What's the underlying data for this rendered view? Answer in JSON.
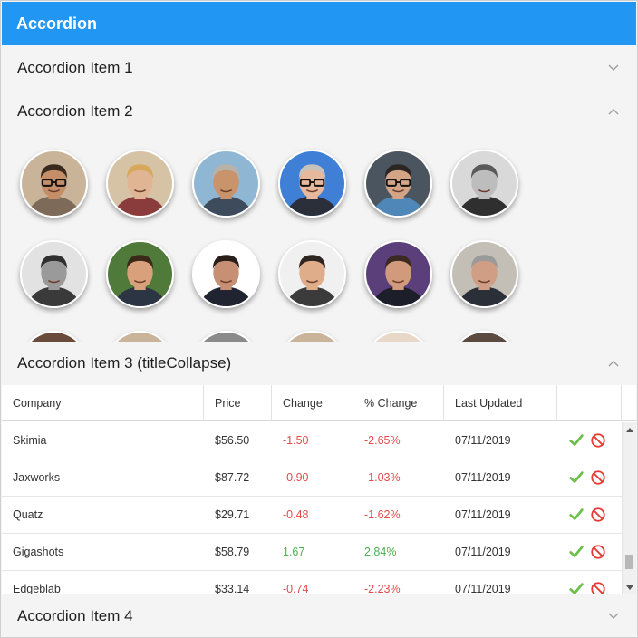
{
  "app": {
    "title": "Accordion"
  },
  "accordion": {
    "item1": {
      "title": "Accordion Item 1",
      "state": "collapsed",
      "icon": "chevron-down-icon"
    },
    "item2": {
      "title": "Accordion Item 2",
      "state": "expanded",
      "icon": "chevron-up-icon"
    },
    "item3": {
      "title": "Accordion Item 3 (titleCollapse)",
      "state": "expanded",
      "icon": "chevron-up-icon"
    },
    "item4": {
      "title": "Accordion Item 4",
      "state": "collapsed",
      "icon": "chevron-down-icon"
    }
  },
  "avatars": [
    {
      "bg": "#c9b49a",
      "skin": "#c48e68",
      "hair": "#3a2a1e",
      "shirt": "#7d6a58",
      "glasses": true
    },
    {
      "bg": "#d6c3a6",
      "skin": "#e0b594",
      "hair": "#d7a85a",
      "shirt": "#8a3b3b",
      "glasses": false
    },
    {
      "bg": "#8fb7d4",
      "skin": "#c9936b",
      "hair": "#b8b2a8",
      "shirt": "#3d4b5c",
      "glasses": false
    },
    {
      "bg": "#3f7fd6",
      "skin": "#e6b99c",
      "hair": "#c7c2bb",
      "shirt": "#2a2f3a",
      "glasses": true
    },
    {
      "bg": "#4a5560",
      "skin": "#d4a486",
      "hair": "#2c2622",
      "shirt": "#4f87b8",
      "glasses": true
    },
    {
      "bg": "#d9d9d9",
      "skin": "#bdbdbd",
      "hair": "#5a5a5a",
      "shirt": "#2f2f2f",
      "glasses": false
    },
    {
      "bg": "#e2e2e2",
      "skin": "#9a9a9a",
      "hair": "#2f2f2f",
      "shirt": "#3a3a3a",
      "glasses": false
    },
    {
      "bg": "#4f7a3a",
      "skin": "#d9a07c",
      "hair": "#3a2818",
      "shirt": "#2c3544",
      "glasses": false
    },
    {
      "bg": "#ffffff",
      "skin": "#c79075",
      "hair": "#2a1f18",
      "shirt": "#1f2430",
      "glasses": false
    },
    {
      "bg": "#f0f0f0",
      "skin": "#e0ad8a",
      "hair": "#2e2520",
      "shirt": "#3b3b3b",
      "glasses": false
    },
    {
      "bg": "#5a3f7a",
      "skin": "#d19a7c",
      "hair": "#3a2a22",
      "shirt": "#1c1f2a",
      "glasses": false
    },
    {
      "bg": "#c3beb6",
      "skin": "#cf9e85",
      "hair": "#9a9a9a",
      "shirt": "#2b2f38",
      "glasses": false
    },
    {
      "bg": "#6a4a3a",
      "skin": "#c48e68",
      "hair": "#2a1c14",
      "shirt": "#333",
      "glasses": false
    },
    {
      "bg": "#c9b49a",
      "skin": "#e0b594",
      "hair": "#8a6a4a",
      "shirt": "#555",
      "glasses": false
    },
    {
      "bg": "#8a8a8a",
      "skin": "#c9936b",
      "hair": "#2a2a2a",
      "shirt": "#333",
      "glasses": false
    },
    {
      "bg": "#c9b49a",
      "skin": "#e0b594",
      "hair": "#6a4a3a",
      "shirt": "#444",
      "glasses": false
    },
    {
      "bg": "#e8d8c8",
      "skin": "#e6b99c",
      "hair": "#e0c0a0",
      "shirt": "#555",
      "glasses": false
    },
    {
      "bg": "#5a4a40",
      "skin": "#d4a486",
      "hair": "#1e1814",
      "shirt": "#333",
      "glasses": false
    }
  ],
  "grid": {
    "columns": [
      "Company",
      "Price",
      "Change",
      "% Change",
      "Last Updated"
    ],
    "rows": [
      {
        "company": "Skimia",
        "price": "$56.50",
        "change": "-1.50",
        "pct": "-2.65%",
        "updated": "07/11/2019",
        "trend": "neg"
      },
      {
        "company": "Jaxworks",
        "price": "$87.72",
        "change": "-0.90",
        "pct": "-1.03%",
        "updated": "07/11/2019",
        "trend": "neg"
      },
      {
        "company": "Quatz",
        "price": "$29.71",
        "change": "-0.48",
        "pct": "-1.62%",
        "updated": "07/11/2019",
        "trend": "neg"
      },
      {
        "company": "Gigashots",
        "price": "$58.79",
        "change": "1.67",
        "pct": "2.84%",
        "updated": "07/11/2019",
        "trend": "pos"
      },
      {
        "company": "Edgeblab",
        "price": "$33.14",
        "change": "-0.74",
        "pct": "-2.23%",
        "updated": "07/11/2019",
        "trend": "neg"
      }
    ],
    "actions": {
      "approve_icon": "checkmark-icon",
      "reject_icon": "ban-icon",
      "approve_color": "#6cc04a",
      "reject_color": "#e53935"
    }
  },
  "colors": {
    "accent": "#2196f3",
    "negative": "#e04b4b",
    "positive": "#4caf50"
  }
}
